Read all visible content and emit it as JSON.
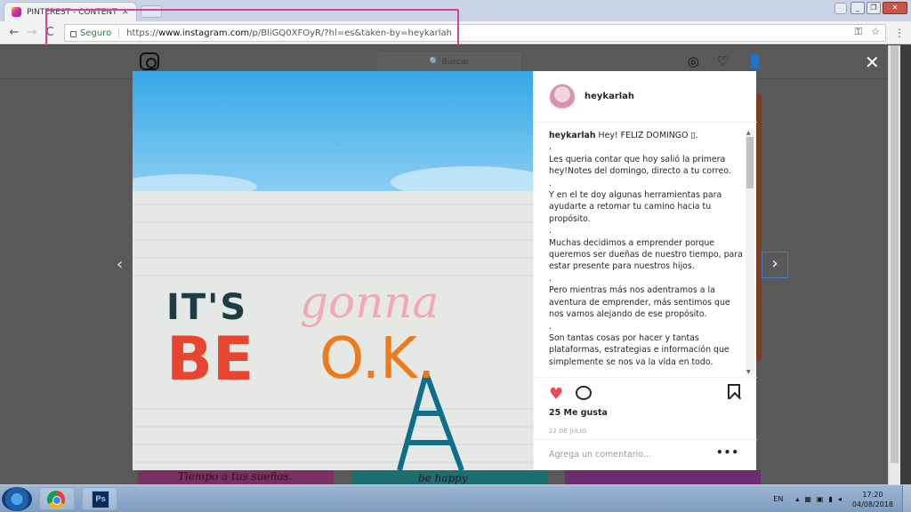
{
  "browser": {
    "tab_title": "PINTEREST - CONTENT",
    "tab_close": "×",
    "secure_label": "Seguro",
    "url_scheme": "https://",
    "url_host": "www.instagram.com",
    "url_path": "/p/BliGQ0XFOyR/?hl=es&taken-by=heykarlah",
    "window_minimize": "_",
    "window_maximize": "❐",
    "window_close": "✕",
    "back": "←",
    "forward": "→",
    "reload": "C",
    "key_icon": "⚿",
    "star_icon": "☆",
    "menu": "⋮"
  },
  "instagram": {
    "search_placeholder": "🔍 Buscar",
    "nav_compass": "◎",
    "nav_heart": "♡",
    "nav_profile": "👤",
    "close": "✕",
    "prev": "‹",
    "next": "›",
    "bg_text_1": "Tiempo a tus sueños.",
    "bg_text_2": "be happy"
  },
  "post": {
    "image": {
      "sign_line1": "IT'S",
      "sign_line1_script": "gonna",
      "sign_line2": "BE",
      "sign_line2_b": "O.K."
    },
    "username": "heykarlah",
    "caption_intro": "Hey! FELIZ DOMINGO ▯.",
    "caption_lines": [
      ".",
      "Les queria contar que hoy salió la primera hey!Notes del domingo, directo a tu correo.",
      ".",
      "Y en el te doy algunas herramientas para ayudarte a retomar tu camino hacia tu propósito.",
      ".",
      "Muchas decidimos a emprender porque queremos ser dueñas de nuestro tiempo, para estar presente para nuestros hijos.",
      ".",
      "Pero mientras más nos adentramos a la aventura de emprender, más sentimos que nos vamos alejando de ese propósito.",
      ".",
      "Son tantas cosas por hacer y tantas plataformas, estrategias e información que simplemente se nos va la vida en todo."
    ],
    "likes": "25 Me gusta",
    "date": "22 DE JULIO",
    "comment_placeholder": "Agrega un comentario...",
    "more": "•••"
  },
  "taskbar": {
    "ps_label": "Ps",
    "language": "EN",
    "time": "17:20",
    "date": "04/08/2018"
  },
  "colors": {
    "accent_highlight": "#d0459b",
    "like_red": "#ed4956",
    "secure_green": "#1b8a3b"
  }
}
